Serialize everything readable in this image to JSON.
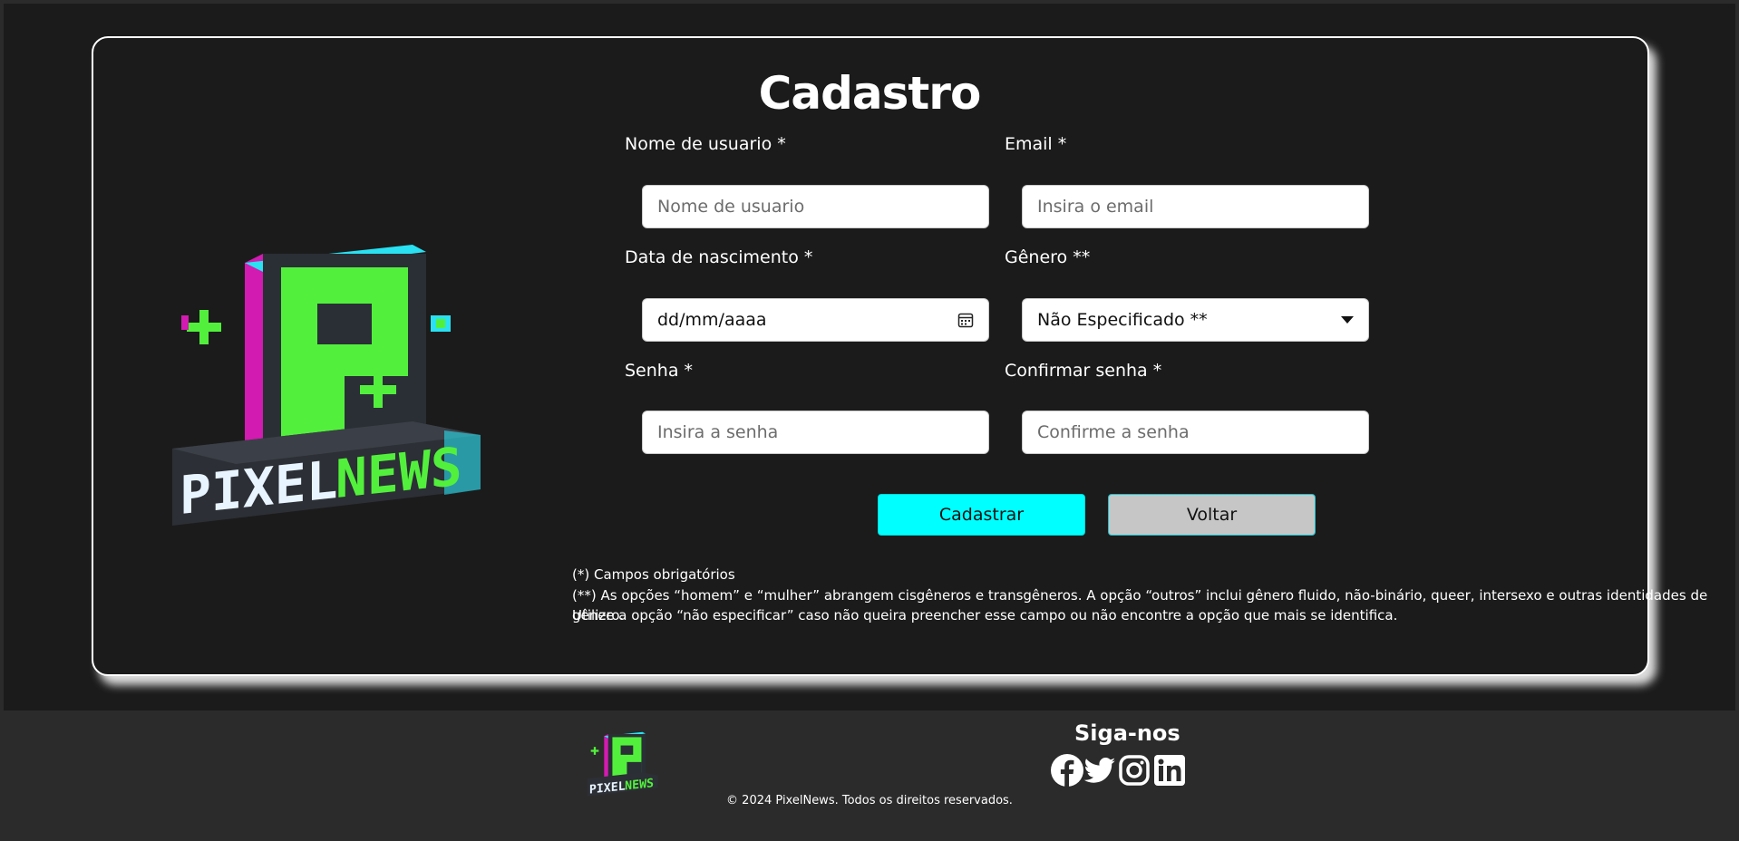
{
  "form": {
    "title": "Cadastro",
    "username": {
      "label": "Nome de usuario *",
      "placeholder": "Nome de usuario"
    },
    "email": {
      "label": "Email *",
      "placeholder": "Insira o email"
    },
    "birthdate": {
      "label": "Data de nascimento *",
      "value": "dd/mm/aaaa",
      "icon": "calendar-icon"
    },
    "gender": {
      "label": "Gênero **",
      "selected": "Não Especificado **",
      "icon": "caret-down-icon"
    },
    "password": {
      "label": "Senha *",
      "placeholder": "Insira a senha"
    },
    "confirm_password": {
      "label": "Confirmar senha *",
      "placeholder": "Confirme a senha"
    },
    "submit_label": "Cadastrar",
    "back_label": "Voltar"
  },
  "notes": {
    "required": "(*) Campos obrigatórios",
    "gender_line1": "(**) As opções “homem” e “mulher” abrangem cisgêneros e transgêneros. A opção “outros” inclui gênero fluido, não-binário, queer, intersexo e outras identidades de gênero.",
    "gender_line2": "Utilize a opção “não especificar” caso não queira preencher esse campo ou não encontre a opção que mais se identifica."
  },
  "logo": {
    "word1": "PIXEL",
    "word2": "NEWS"
  },
  "footer": {
    "copyright": "© 2024 PixelNews. Todos os direitos reservados.",
    "follow_title": "Siga-nos",
    "social": [
      "facebook-icon",
      "twitter-icon",
      "instagram-icon",
      "linkedin-icon"
    ]
  },
  "colors": {
    "accent": "#00ffff",
    "neon_green": "#39ff14",
    "magenta": "#ff1fbf",
    "background": "#1b1b1b"
  }
}
